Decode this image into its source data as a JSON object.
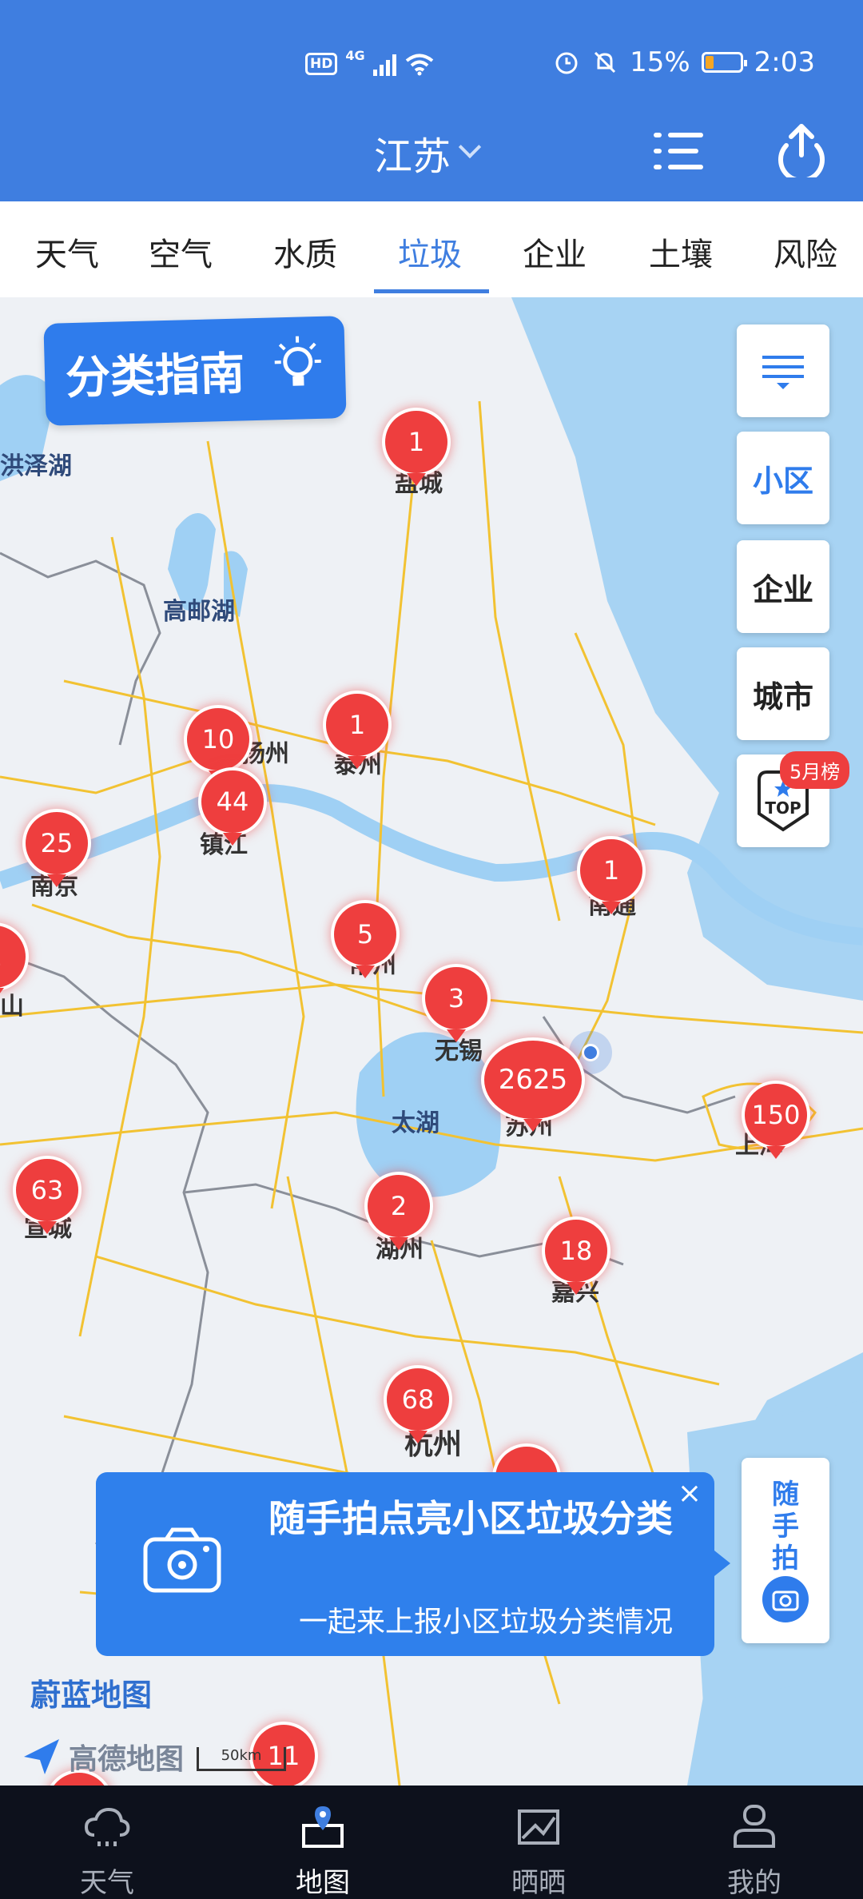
{
  "status_bar": {
    "left": "HD",
    "network": "4G",
    "battery": "15%",
    "time": "2:03"
  },
  "header": {
    "region": "江苏"
  },
  "tabs": [
    {
      "label": "天气"
    },
    {
      "label": "空气"
    },
    {
      "label": "水质"
    },
    {
      "label": "垃圾",
      "active": true
    },
    {
      "label": "企业"
    },
    {
      "label": "土壤"
    },
    {
      "label": "风险"
    }
  ],
  "map": {
    "guide_label": "分类指南",
    "side_buttons": [
      "小区",
      "企业",
      "城市"
    ],
    "top_badge": "5月榜",
    "top_label": "TOP",
    "places": [
      "洪泽湖",
      "高邮湖",
      "盐城",
      "扬州",
      "泰州",
      "镇江",
      "南京",
      "常州",
      "南通",
      "无锡",
      "太湖",
      "苏州",
      "上海",
      "宣城",
      "湖州",
      "嘉兴",
      "杭州",
      "山"
    ],
    "pins": [
      "1",
      "10",
      "1",
      "44",
      "25",
      "1",
      "2",
      "5",
      "3",
      "2625",
      "150",
      "63",
      "2",
      "18",
      "68",
      "11"
    ],
    "watermark": "蔚蓝地图",
    "amap": "高德地图",
    "scale": "50km"
  },
  "banner": {
    "title": "随手拍点亮小区垃圾分类",
    "subtitle": "一起来上报小区垃圾分类情况",
    "close": "×"
  },
  "snap_button": {
    "label": "随手拍"
  },
  "bottom_nav": [
    {
      "label": "天气"
    },
    {
      "label": "地图",
      "active": true
    },
    {
      "label": "晒晒"
    },
    {
      "label": "我的"
    }
  ],
  "colors": {
    "header": "#3f7ee0",
    "pin": "#ee3e3e",
    "accent": "#2f7cec",
    "nav": "#0d111c"
  }
}
